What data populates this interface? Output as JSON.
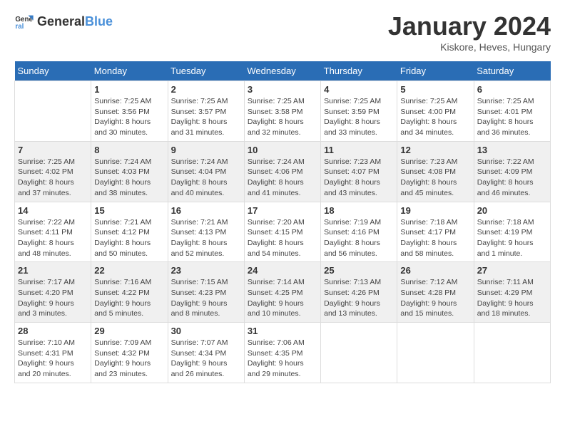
{
  "logo": {
    "general": "General",
    "blue": "Blue"
  },
  "title": "January 2024",
  "subtitle": "Kiskore, Heves, Hungary",
  "days_header": [
    "Sunday",
    "Monday",
    "Tuesday",
    "Wednesday",
    "Thursday",
    "Friday",
    "Saturday"
  ],
  "weeks": [
    [
      {
        "day": "",
        "info": ""
      },
      {
        "day": "1",
        "info": "Sunrise: 7:25 AM\nSunset: 3:56 PM\nDaylight: 8 hours\nand 30 minutes."
      },
      {
        "day": "2",
        "info": "Sunrise: 7:25 AM\nSunset: 3:57 PM\nDaylight: 8 hours\nand 31 minutes."
      },
      {
        "day": "3",
        "info": "Sunrise: 7:25 AM\nSunset: 3:58 PM\nDaylight: 8 hours\nand 32 minutes."
      },
      {
        "day": "4",
        "info": "Sunrise: 7:25 AM\nSunset: 3:59 PM\nDaylight: 8 hours\nand 33 minutes."
      },
      {
        "day": "5",
        "info": "Sunrise: 7:25 AM\nSunset: 4:00 PM\nDaylight: 8 hours\nand 34 minutes."
      },
      {
        "day": "6",
        "info": "Sunrise: 7:25 AM\nSunset: 4:01 PM\nDaylight: 8 hours\nand 36 minutes."
      }
    ],
    [
      {
        "day": "7",
        "info": "Sunrise: 7:25 AM\nSunset: 4:02 PM\nDaylight: 8 hours\nand 37 minutes."
      },
      {
        "day": "8",
        "info": "Sunrise: 7:24 AM\nSunset: 4:03 PM\nDaylight: 8 hours\nand 38 minutes."
      },
      {
        "day": "9",
        "info": "Sunrise: 7:24 AM\nSunset: 4:04 PM\nDaylight: 8 hours\nand 40 minutes."
      },
      {
        "day": "10",
        "info": "Sunrise: 7:24 AM\nSunset: 4:06 PM\nDaylight: 8 hours\nand 41 minutes."
      },
      {
        "day": "11",
        "info": "Sunrise: 7:23 AM\nSunset: 4:07 PM\nDaylight: 8 hours\nand 43 minutes."
      },
      {
        "day": "12",
        "info": "Sunrise: 7:23 AM\nSunset: 4:08 PM\nDaylight: 8 hours\nand 45 minutes."
      },
      {
        "day": "13",
        "info": "Sunrise: 7:22 AM\nSunset: 4:09 PM\nDaylight: 8 hours\nand 46 minutes."
      }
    ],
    [
      {
        "day": "14",
        "info": "Sunrise: 7:22 AM\nSunset: 4:11 PM\nDaylight: 8 hours\nand 48 minutes."
      },
      {
        "day": "15",
        "info": "Sunrise: 7:21 AM\nSunset: 4:12 PM\nDaylight: 8 hours\nand 50 minutes."
      },
      {
        "day": "16",
        "info": "Sunrise: 7:21 AM\nSunset: 4:13 PM\nDaylight: 8 hours\nand 52 minutes."
      },
      {
        "day": "17",
        "info": "Sunrise: 7:20 AM\nSunset: 4:15 PM\nDaylight: 8 hours\nand 54 minutes."
      },
      {
        "day": "18",
        "info": "Sunrise: 7:19 AM\nSunset: 4:16 PM\nDaylight: 8 hours\nand 56 minutes."
      },
      {
        "day": "19",
        "info": "Sunrise: 7:18 AM\nSunset: 4:17 PM\nDaylight: 8 hours\nand 58 minutes."
      },
      {
        "day": "20",
        "info": "Sunrise: 7:18 AM\nSunset: 4:19 PM\nDaylight: 9 hours\nand 1 minute."
      }
    ],
    [
      {
        "day": "21",
        "info": "Sunrise: 7:17 AM\nSunset: 4:20 PM\nDaylight: 9 hours\nand 3 minutes."
      },
      {
        "day": "22",
        "info": "Sunrise: 7:16 AM\nSunset: 4:22 PM\nDaylight: 9 hours\nand 5 minutes."
      },
      {
        "day": "23",
        "info": "Sunrise: 7:15 AM\nSunset: 4:23 PM\nDaylight: 9 hours\nand 8 minutes."
      },
      {
        "day": "24",
        "info": "Sunrise: 7:14 AM\nSunset: 4:25 PM\nDaylight: 9 hours\nand 10 minutes."
      },
      {
        "day": "25",
        "info": "Sunrise: 7:13 AM\nSunset: 4:26 PM\nDaylight: 9 hours\nand 13 minutes."
      },
      {
        "day": "26",
        "info": "Sunrise: 7:12 AM\nSunset: 4:28 PM\nDaylight: 9 hours\nand 15 minutes."
      },
      {
        "day": "27",
        "info": "Sunrise: 7:11 AM\nSunset: 4:29 PM\nDaylight: 9 hours\nand 18 minutes."
      }
    ],
    [
      {
        "day": "28",
        "info": "Sunrise: 7:10 AM\nSunset: 4:31 PM\nDaylight: 9 hours\nand 20 minutes."
      },
      {
        "day": "29",
        "info": "Sunrise: 7:09 AM\nSunset: 4:32 PM\nDaylight: 9 hours\nand 23 minutes."
      },
      {
        "day": "30",
        "info": "Sunrise: 7:07 AM\nSunset: 4:34 PM\nDaylight: 9 hours\nand 26 minutes."
      },
      {
        "day": "31",
        "info": "Sunrise: 7:06 AM\nSunset: 4:35 PM\nDaylight: 9 hours\nand 29 minutes."
      },
      {
        "day": "",
        "info": ""
      },
      {
        "day": "",
        "info": ""
      },
      {
        "day": "",
        "info": ""
      }
    ]
  ]
}
